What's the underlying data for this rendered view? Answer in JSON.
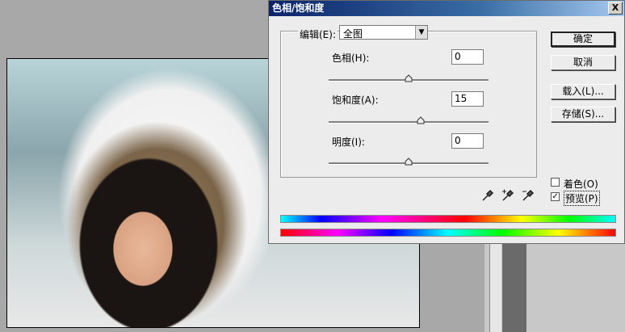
{
  "dialog": {
    "title": "色相/饱和度",
    "close_glyph": "X",
    "edit": {
      "label": "编辑(E):",
      "selected": "全图"
    },
    "hue": {
      "label": "色相(H):",
      "value": "0",
      "slider_fraction": 0.5
    },
    "saturation": {
      "label": "饱和度(A):",
      "value": "15",
      "slider_fraction": 0.575
    },
    "lightness": {
      "label": "明度(I):",
      "value": "0",
      "slider_fraction": 0.5
    },
    "buttons": {
      "ok": "确定",
      "cancel": "取消",
      "load": "载入(L)...",
      "save": "存储(S)..."
    },
    "colorize": {
      "label": "着色(O)",
      "checked": false
    },
    "preview": {
      "label": "预览(P)",
      "checked": true,
      "check_glyph": "✓"
    }
  },
  "icons": [
    "eyedropper-icon",
    "eyedropper-plus-icon",
    "eyedropper-minus-icon"
  ]
}
